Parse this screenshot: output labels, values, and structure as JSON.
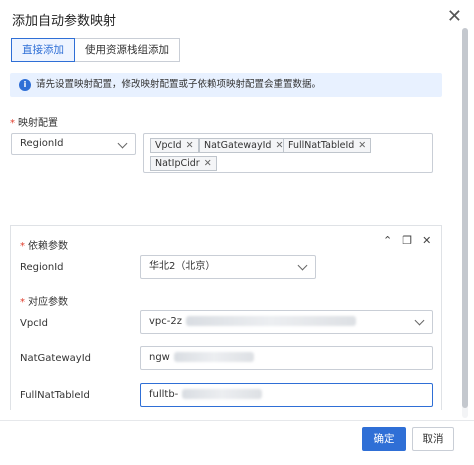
{
  "dialog": {
    "title": "添加自动参数映射"
  },
  "tabs": [
    {
      "label": "直接添加",
      "active": true
    },
    {
      "label": "使用资源栈组添加",
      "active": false
    }
  ],
  "notice": {
    "text": "请先设置映射配置，修改映射配置或子依赖项映射配置会重置数据。"
  },
  "mapping": {
    "label": "映射配置",
    "select_value": "RegionId",
    "tags": [
      "VpcId",
      "NatGatewayId",
      "FullNatTableId",
      "NatIpCidr"
    ]
  },
  "card": {
    "dep_label": "依赖参数",
    "region_label": "RegionId",
    "region_value": "华北2（北京）",
    "corr_label": "对应参数",
    "fields": [
      {
        "label": "VpcId",
        "value": "vpc-2z"
      },
      {
        "label": "NatGatewayId",
        "value": "ngw"
      },
      {
        "label": "FullNatTableId",
        "value": "fulltb-"
      }
    ]
  },
  "footer": {
    "confirm": "确定",
    "cancel": "取消"
  },
  "colors": {
    "accent": "#2f6fd6",
    "required": "#e03e2d",
    "notice_bg": "#e8f1ff"
  }
}
